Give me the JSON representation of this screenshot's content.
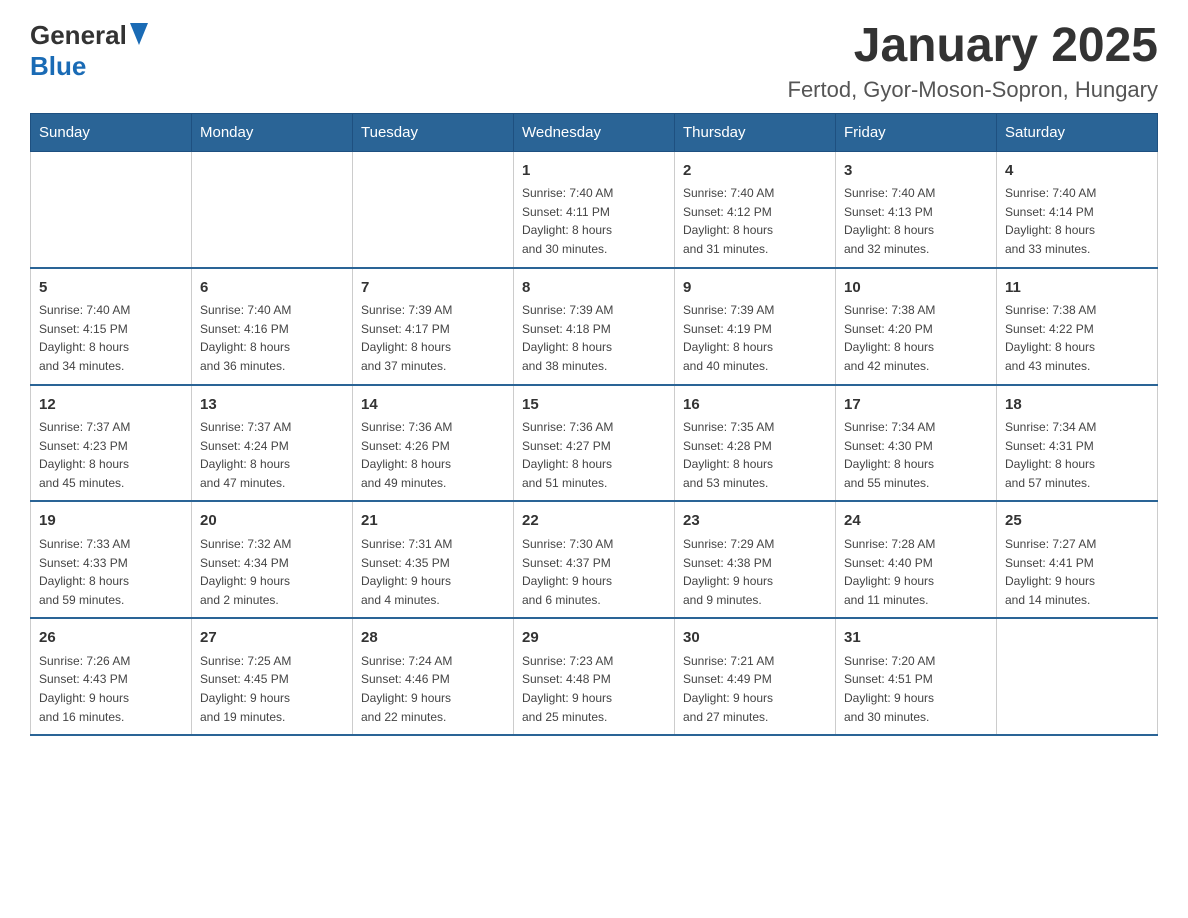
{
  "logo": {
    "general": "General",
    "blue": "Blue"
  },
  "title": "January 2025",
  "location": "Fertod, Gyor-Moson-Sopron, Hungary",
  "days_of_week": [
    "Sunday",
    "Monday",
    "Tuesday",
    "Wednesday",
    "Thursday",
    "Friday",
    "Saturday"
  ],
  "weeks": [
    [
      {
        "day": "",
        "info": ""
      },
      {
        "day": "",
        "info": ""
      },
      {
        "day": "",
        "info": ""
      },
      {
        "day": "1",
        "info": "Sunrise: 7:40 AM\nSunset: 4:11 PM\nDaylight: 8 hours\nand 30 minutes."
      },
      {
        "day": "2",
        "info": "Sunrise: 7:40 AM\nSunset: 4:12 PM\nDaylight: 8 hours\nand 31 minutes."
      },
      {
        "day": "3",
        "info": "Sunrise: 7:40 AM\nSunset: 4:13 PM\nDaylight: 8 hours\nand 32 minutes."
      },
      {
        "day": "4",
        "info": "Sunrise: 7:40 AM\nSunset: 4:14 PM\nDaylight: 8 hours\nand 33 minutes."
      }
    ],
    [
      {
        "day": "5",
        "info": "Sunrise: 7:40 AM\nSunset: 4:15 PM\nDaylight: 8 hours\nand 34 minutes."
      },
      {
        "day": "6",
        "info": "Sunrise: 7:40 AM\nSunset: 4:16 PM\nDaylight: 8 hours\nand 36 minutes."
      },
      {
        "day": "7",
        "info": "Sunrise: 7:39 AM\nSunset: 4:17 PM\nDaylight: 8 hours\nand 37 minutes."
      },
      {
        "day": "8",
        "info": "Sunrise: 7:39 AM\nSunset: 4:18 PM\nDaylight: 8 hours\nand 38 minutes."
      },
      {
        "day": "9",
        "info": "Sunrise: 7:39 AM\nSunset: 4:19 PM\nDaylight: 8 hours\nand 40 minutes."
      },
      {
        "day": "10",
        "info": "Sunrise: 7:38 AM\nSunset: 4:20 PM\nDaylight: 8 hours\nand 42 minutes."
      },
      {
        "day": "11",
        "info": "Sunrise: 7:38 AM\nSunset: 4:22 PM\nDaylight: 8 hours\nand 43 minutes."
      }
    ],
    [
      {
        "day": "12",
        "info": "Sunrise: 7:37 AM\nSunset: 4:23 PM\nDaylight: 8 hours\nand 45 minutes."
      },
      {
        "day": "13",
        "info": "Sunrise: 7:37 AM\nSunset: 4:24 PM\nDaylight: 8 hours\nand 47 minutes."
      },
      {
        "day": "14",
        "info": "Sunrise: 7:36 AM\nSunset: 4:26 PM\nDaylight: 8 hours\nand 49 minutes."
      },
      {
        "day": "15",
        "info": "Sunrise: 7:36 AM\nSunset: 4:27 PM\nDaylight: 8 hours\nand 51 minutes."
      },
      {
        "day": "16",
        "info": "Sunrise: 7:35 AM\nSunset: 4:28 PM\nDaylight: 8 hours\nand 53 minutes."
      },
      {
        "day": "17",
        "info": "Sunrise: 7:34 AM\nSunset: 4:30 PM\nDaylight: 8 hours\nand 55 minutes."
      },
      {
        "day": "18",
        "info": "Sunrise: 7:34 AM\nSunset: 4:31 PM\nDaylight: 8 hours\nand 57 minutes."
      }
    ],
    [
      {
        "day": "19",
        "info": "Sunrise: 7:33 AM\nSunset: 4:33 PM\nDaylight: 8 hours\nand 59 minutes."
      },
      {
        "day": "20",
        "info": "Sunrise: 7:32 AM\nSunset: 4:34 PM\nDaylight: 9 hours\nand 2 minutes."
      },
      {
        "day": "21",
        "info": "Sunrise: 7:31 AM\nSunset: 4:35 PM\nDaylight: 9 hours\nand 4 minutes."
      },
      {
        "day": "22",
        "info": "Sunrise: 7:30 AM\nSunset: 4:37 PM\nDaylight: 9 hours\nand 6 minutes."
      },
      {
        "day": "23",
        "info": "Sunrise: 7:29 AM\nSunset: 4:38 PM\nDaylight: 9 hours\nand 9 minutes."
      },
      {
        "day": "24",
        "info": "Sunrise: 7:28 AM\nSunset: 4:40 PM\nDaylight: 9 hours\nand 11 minutes."
      },
      {
        "day": "25",
        "info": "Sunrise: 7:27 AM\nSunset: 4:41 PM\nDaylight: 9 hours\nand 14 minutes."
      }
    ],
    [
      {
        "day": "26",
        "info": "Sunrise: 7:26 AM\nSunset: 4:43 PM\nDaylight: 9 hours\nand 16 minutes."
      },
      {
        "day": "27",
        "info": "Sunrise: 7:25 AM\nSunset: 4:45 PM\nDaylight: 9 hours\nand 19 minutes."
      },
      {
        "day": "28",
        "info": "Sunrise: 7:24 AM\nSunset: 4:46 PM\nDaylight: 9 hours\nand 22 minutes."
      },
      {
        "day": "29",
        "info": "Sunrise: 7:23 AM\nSunset: 4:48 PM\nDaylight: 9 hours\nand 25 minutes."
      },
      {
        "day": "30",
        "info": "Sunrise: 7:21 AM\nSunset: 4:49 PM\nDaylight: 9 hours\nand 27 minutes."
      },
      {
        "day": "31",
        "info": "Sunrise: 7:20 AM\nSunset: 4:51 PM\nDaylight: 9 hours\nand 30 minutes."
      },
      {
        "day": "",
        "info": ""
      }
    ]
  ]
}
